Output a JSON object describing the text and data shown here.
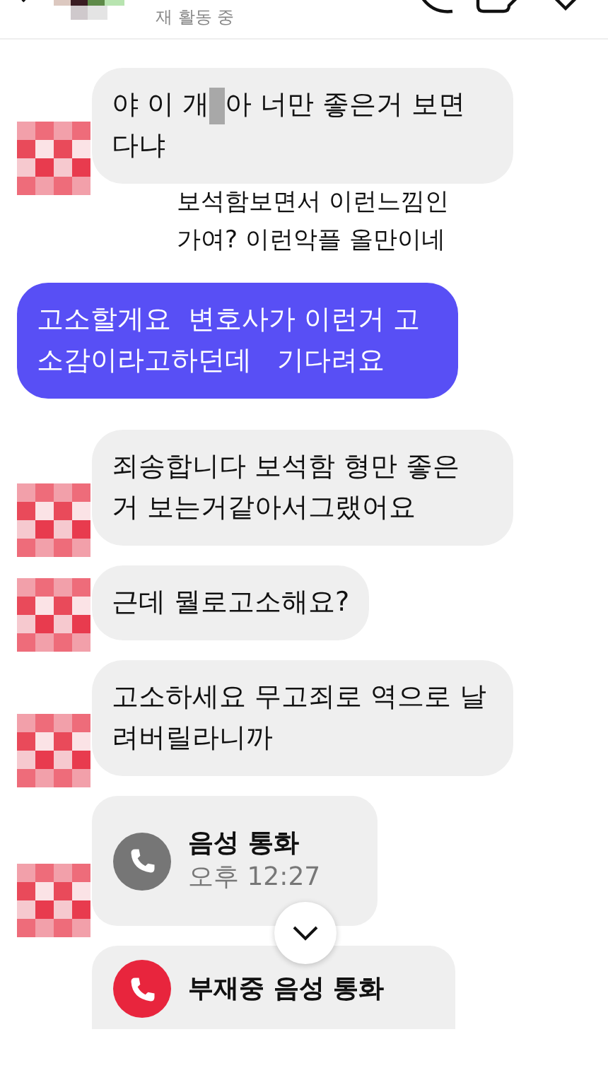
{
  "header": {
    "status": "재 활동 중"
  },
  "messages": [
    {
      "kind": "censored",
      "from_me": false,
      "avatar": true,
      "parts": [
        "야 이 개",
        "아 너만 좋은거 보면 다냐"
      ]
    },
    {
      "kind": "caption",
      "text": "보석함보면서 이런느낌인 가여? 이런악플 올만이네"
    },
    {
      "kind": "text",
      "from_me": true,
      "text": "고소할게요  변호사가 이런거 고소감이라고하던데   기다려요"
    },
    {
      "kind": "text",
      "from_me": false,
      "avatar": true,
      "text": "죄송합니다 보석함 형만 좋은 거 보는거같아서그랬어요"
    },
    {
      "kind": "text",
      "from_me": false,
      "avatar": true,
      "text": "근데 뭘로고소해요?"
    },
    {
      "kind": "text",
      "from_me": false,
      "avatar": true,
      "text": "고소하세요 무고죄로 역으로 날려버릴라니까"
    },
    {
      "kind": "call",
      "from_me": false,
      "avatar": true,
      "missed": false,
      "title": "음성 통화",
      "time": "오후 12:27"
    },
    {
      "kind": "scroll_button"
    },
    {
      "kind": "call",
      "from_me": false,
      "avatar": false,
      "missed": true,
      "title": "부재중 음성 통화"
    }
  ]
}
